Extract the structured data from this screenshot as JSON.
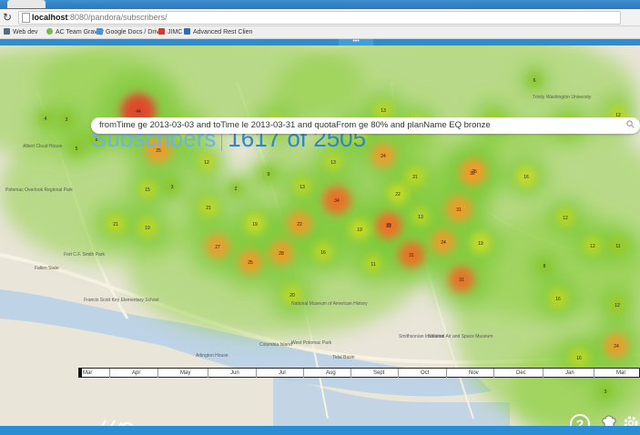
{
  "browser": {
    "url_host": "localhost",
    "url_rest": ":8080/pandora/subscribers/",
    "bookmarks": [
      "Web dev",
      "AC Team Gravity",
      "Google Docs / Drive",
      "JIMC",
      "Advanced Rest Clien"
    ]
  },
  "header": {
    "title": "Subscribers",
    "count": "1617 of 2505"
  },
  "search": {
    "query": "fromTime ge 2013-03-03 and toTime le 2013-03-31 and quotaFrom ge 80% and planName EQ bronze"
  },
  "timeline": {
    "months": [
      "Mar",
      "Apr",
      "May",
      "Jun",
      "Jul",
      "Aug",
      "Sept",
      "Oct",
      "Nov",
      "Dec",
      "Jan",
      "Mar"
    ]
  },
  "map": {
    "place_labels": [
      "Albert Cloud House",
      "Potomac Overlook Regional Park",
      "Fort C.F. Smith Park",
      "Fallen State",
      "Francis Scott Key Elementary School",
      "Columbia Island",
      "Arlington House",
      "Tidal Basin",
      "National Museum of American History",
      "West Potomac Park",
      "Smithsonian Institution",
      "National Air and Space Museum",
      "Trinity Washington University"
    ],
    "clusters": [
      {
        "label": "44",
        "color": "#e83c2a"
      },
      {
        "label": "22",
        "color": "#cfdd20"
      },
      {
        "label": "25",
        "color": "#f29a2a"
      },
      {
        "label": "21",
        "color": "#bfd81f"
      },
      {
        "label": "17",
        "color": "#cfdd20"
      },
      {
        "label": "13",
        "color": "#bfd81f"
      },
      {
        "label": "11",
        "color": "#bfd81f"
      },
      {
        "label": "10",
        "color": "#9fcc1f"
      },
      {
        "label": "11",
        "color": "#9fcc1f"
      },
      {
        "label": "12",
        "color": "#bfd81f"
      },
      {
        "label": "6",
        "color": "#8cc31f"
      },
      {
        "label": "4",
        "color": "#8cc31f"
      },
      {
        "label": "3",
        "color": "#8cc31f"
      },
      {
        "label": "8",
        "color": "#8cc31f"
      },
      {
        "label": "5",
        "color": "#8cc31f"
      },
      {
        "label": "12",
        "color": "#bfd81f"
      },
      {
        "label": "3",
        "color": "#8cc31f"
      },
      {
        "label": "13",
        "color": "#bfd81f"
      },
      {
        "label": "24",
        "color": "#f29a2a"
      },
      {
        "label": "25",
        "color": "#f29a2a"
      },
      {
        "label": "32",
        "color": "#f29a2a"
      },
      {
        "label": "16",
        "color": "#cfdd20"
      },
      {
        "label": "2",
        "color": "#8cc31f"
      },
      {
        "label": "9",
        "color": "#8cc31f"
      },
      {
        "label": "21",
        "color": "#bfd81f"
      },
      {
        "label": "22",
        "color": "#cfdd20"
      },
      {
        "label": "34",
        "color": "#ef6a25"
      },
      {
        "label": "13",
        "color": "#bfd81f"
      },
      {
        "label": "15",
        "color": "#bfd81f"
      },
      {
        "label": "31",
        "color": "#f29a2a"
      },
      {
        "label": "19",
        "color": "#cfdd20"
      },
      {
        "label": "13",
        "color": "#bfd81f"
      },
      {
        "label": "21",
        "color": "#bfd81f"
      },
      {
        "label": "19",
        "color": "#bfd81f"
      },
      {
        "label": "21",
        "color": "#bfd81f"
      },
      {
        "label": "22",
        "color": "#f29a2a"
      },
      {
        "label": "19",
        "color": "#cfdd20"
      },
      {
        "label": "29",
        "color": "#f29a2a"
      },
      {
        "label": "31",
        "color": "#ef6a25"
      },
      {
        "label": "24",
        "color": "#f29a2a"
      },
      {
        "label": "19",
        "color": "#cfdd20"
      },
      {
        "label": "27",
        "color": "#f29a2a"
      },
      {
        "label": "28",
        "color": "#f29a2a"
      },
      {
        "label": "25",
        "color": "#f29a2a"
      },
      {
        "label": "16",
        "color": "#bfd81f"
      },
      {
        "label": "11",
        "color": "#bfd81f"
      },
      {
        "label": "31",
        "color": "#ef6a25"
      },
      {
        "label": "31",
        "color": "#ef6a25"
      },
      {
        "label": "20",
        "color": "#bfd81f"
      },
      {
        "label": "12",
        "color": "#bfd81f"
      },
      {
        "label": "12",
        "color": "#bfd81f"
      },
      {
        "label": "8",
        "color": "#8cc31f"
      },
      {
        "label": "11",
        "color": "#9fcc1f"
      },
      {
        "label": "12",
        "color": "#9fcc1f"
      },
      {
        "label": "16",
        "color": "#bfd81f"
      },
      {
        "label": "24",
        "color": "#f29a2a"
      },
      {
        "label": "16",
        "color": "#bfd81f"
      },
      {
        "label": "3",
        "color": "#8cc31f"
      }
    ]
  },
  "controls": {
    "help_label": "?"
  },
  "colors": {
    "accent": "#2b8dd3",
    "title_light": "#6bb4e6",
    "title_bold": "#2f86c9"
  }
}
